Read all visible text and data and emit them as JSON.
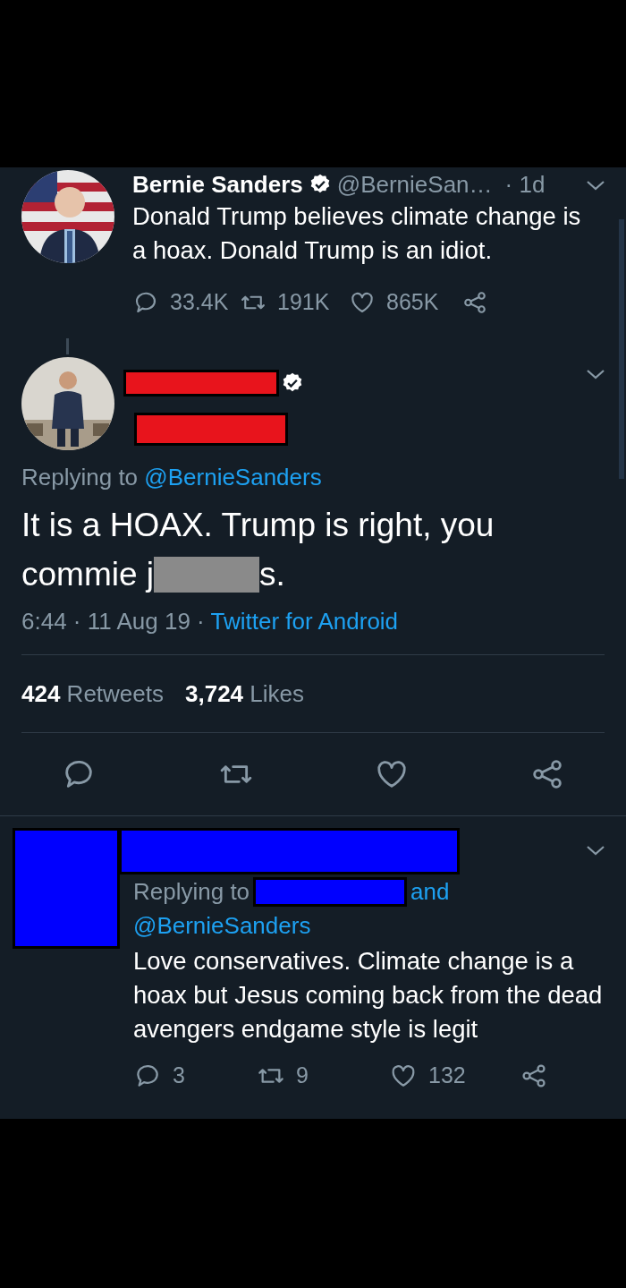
{
  "top_tweet": {
    "name": "Bernie Sanders",
    "verified": true,
    "handle": "@BernieSan…",
    "time": "· 1d",
    "text": "Donald Trump believes climate change is a hoax. Donald Trump is an idiot.",
    "actions": [
      {
        "kind": "reply",
        "count": "33.4K"
      },
      {
        "kind": "retweet",
        "count": "191K"
      },
      {
        "kind": "like",
        "count": "865K"
      },
      {
        "kind": "share"
      }
    ]
  },
  "main_tweet": {
    "verified": true,
    "replying_label": "Replying to",
    "replying_to": "@BernieSanders",
    "text_before": "It is a HOAX. Trump is right, you commie j",
    "text_after": "s.",
    "timestamp": "6:44 · 11 Aug 19 ·",
    "source": "Twitter for Android",
    "stats": [
      "**424** Retweets",
      "**3,724** Likes"
    ],
    "actions": [
      {
        "kind": "reply"
      },
      {
        "kind": "retweet"
      },
      {
        "kind": "like"
      },
      {
        "kind": "share"
      }
    ]
  },
  "reply_tweet": {
    "replying_label": "Replying to",
    "and_label": "and",
    "replying_to": "@BernieSanders",
    "text": "Love conservatives. Climate change is a hoax but Jesus coming back from the dead avengers endgame style is legit",
    "actions": [
      {
        "kind": "reply",
        "count": "3"
      },
      {
        "kind": "retweet",
        "count": "9"
      },
      {
        "kind": "like",
        "count": "132"
      },
      {
        "kind": "share"
      }
    ]
  }
}
